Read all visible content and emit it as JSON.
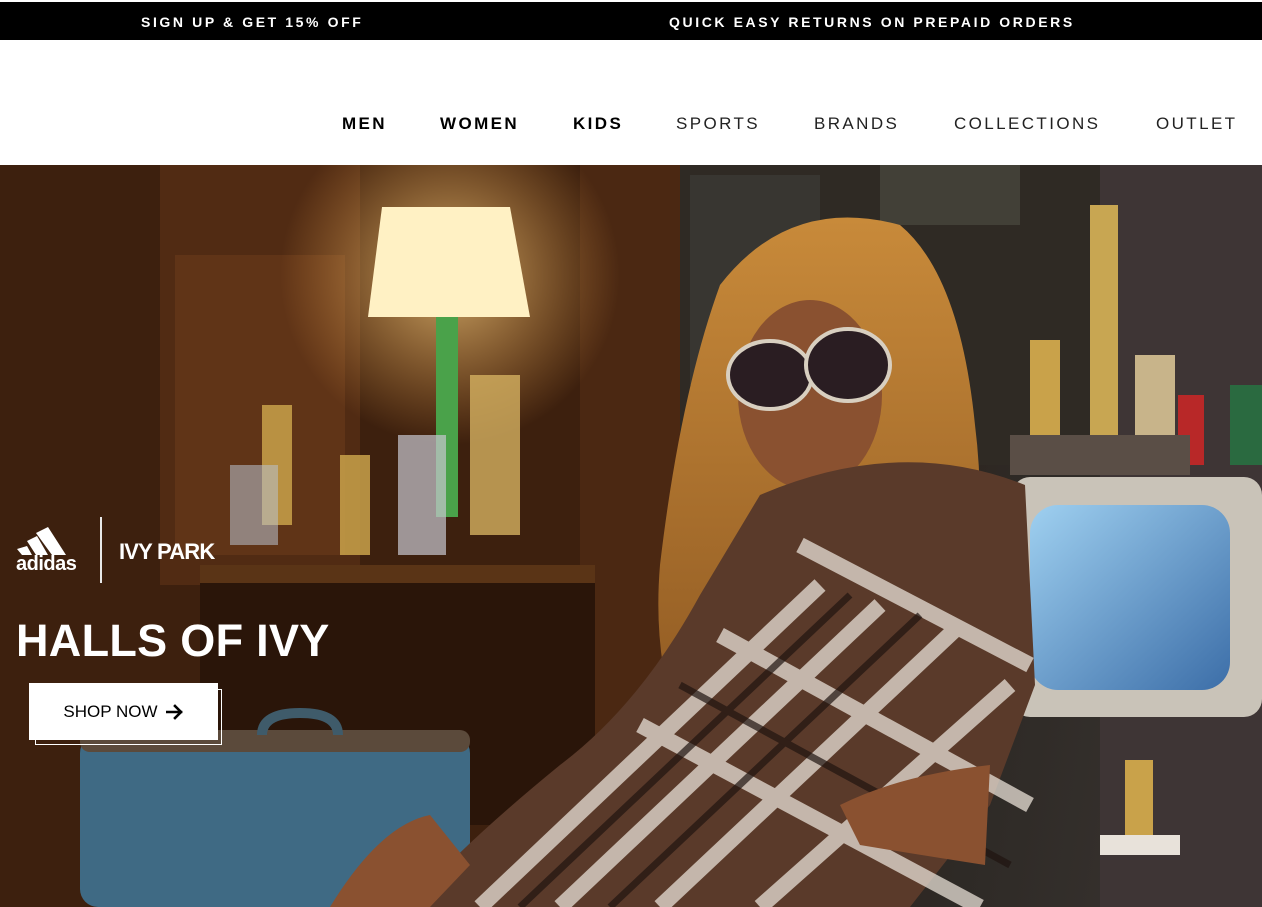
{
  "promo": {
    "left_text": "SIGN UP & GET 15% OFF",
    "right_text": "QUICK EASY RETURNS ON PREPAID ORDERS"
  },
  "nav": {
    "items": [
      {
        "label": "MEN"
      },
      {
        "label": "WOMEN"
      },
      {
        "label": "KIDS"
      },
      {
        "label": "SPORTS"
      },
      {
        "label": "BRANDS"
      },
      {
        "label": "COLLECTIONS"
      },
      {
        "label": "OUTLET"
      }
    ]
  },
  "hero": {
    "brand_adidas": "adidas",
    "brand_partner": "IVY PARK",
    "title": "HALLS OF IVY",
    "cta_label": "SHOP NOW"
  },
  "colors": {
    "promo_bg": "#000000",
    "text_on_dark": "#ffffff",
    "cta_bg": "#ffffff"
  },
  "icons": [
    "adidas-logo-icon",
    "arrow-right-icon"
  ]
}
